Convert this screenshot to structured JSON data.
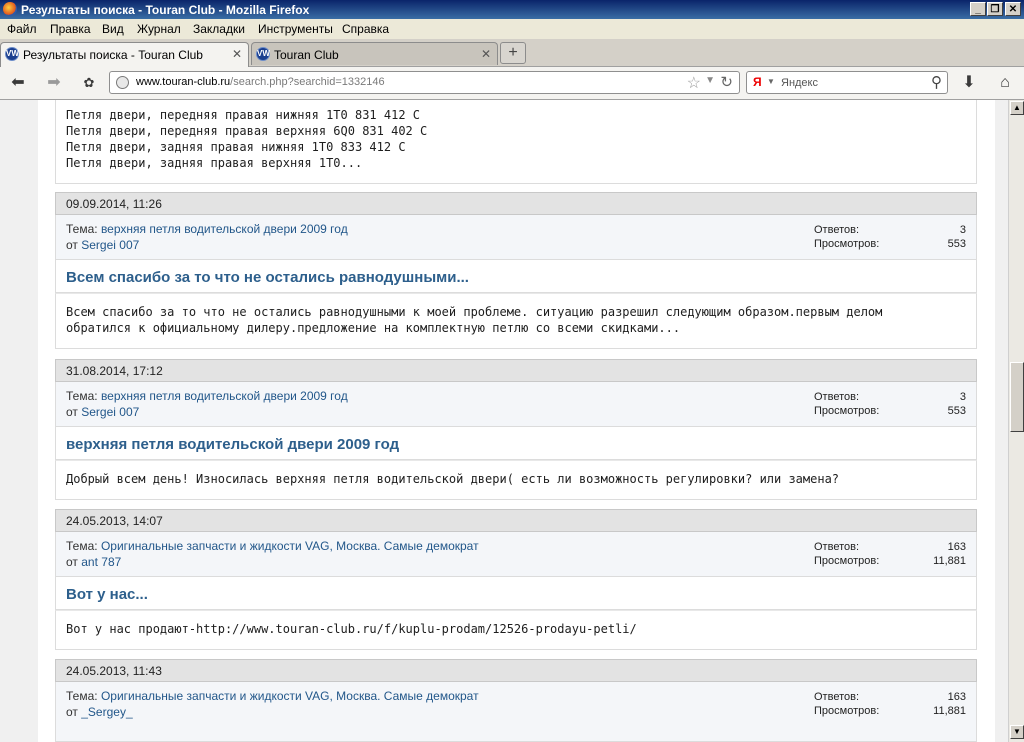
{
  "window": {
    "title": "Результаты поиска - Touran Club - Mozilla Firefox"
  },
  "menu": [
    "Файл",
    "Правка",
    "Вид",
    "Журнал",
    "Закладки",
    "Инструменты",
    "Справка"
  ],
  "tabs": [
    {
      "label": "Результаты поиска - Touran Club",
      "active": true
    },
    {
      "label": "Touran Club",
      "active": false
    }
  ],
  "nav": {
    "url_domain": "www.touran-club.ru",
    "url_path": "/search.php?searchid=1332146",
    "search_placeholder": "Яндекс"
  },
  "top_post_lines": [
    "Петля двери, передняя правая нижняя 1T0 831 412 C",
    "Петля двери, передняя правая верхняя 6Q0 831 402 C",
    "Петля двери, задняя правая нижняя 1T0 833 412 C",
    "Петля двери, задняя правая верхняя 1T0..."
  ],
  "labels": {
    "topic": "Тема:",
    "from": "от",
    "replies": "Ответов:",
    "views": "Просмотров:"
  },
  "results": [
    {
      "date": "09.09.2014,   11:26",
      "topic": "верхняя петля водительской двери 2009 год",
      "author": "Sergei 007",
      "replies": "3",
      "views": "553",
      "title": "Всем спасибо за то что не остались равнодушными...",
      "lines": [
        "Всем спасибо за то что не остались равнодушными к моей проблеме. ситуацию разрешил следующим образом.первым делом",
        "обратился к официальному дилеру.предложение на комплектную петлю со всеми скидками..."
      ]
    },
    {
      "date": "31.08.2014,   17:12",
      "topic": "верхняя петля водительской двери 2009 год",
      "author": "Sergei 007",
      "replies": "3",
      "views": "553",
      "title": "верхняя петля водительской двери 2009 год",
      "lines": [
        "Добрый всем день! Износилась верхняя петля водительской двери( есть ли возможность регулировки? или замена?"
      ]
    },
    {
      "date": "24.05.2013,   14:07",
      "topic": "Оригинальные запчасти и жидкости VAG, Москва. Самые демократ",
      "author": "ant 787",
      "replies": "163",
      "views": "11,881",
      "title": "Вот у нас...",
      "lines": [
        "Вот у нас продают-http://www.touran-club.ru/f/kuplu-prodam/12526-prodayu-petli/"
      ]
    },
    {
      "date": "24.05.2013,   11:43",
      "topic": "Оригинальные запчасти и жидкости VAG, Москва. Самые демократ",
      "author": "_Sergey_",
      "replies": "163",
      "views": "11,881",
      "title": "",
      "lines": []
    }
  ]
}
